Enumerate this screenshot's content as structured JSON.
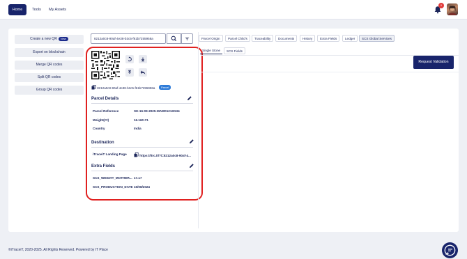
{
  "nav": {
    "home": "Home",
    "tools": "Tools",
    "assets": "My Assets",
    "notification_count": "0"
  },
  "menu": {
    "create": "Create a new QR",
    "new_badge": "New",
    "export": "Export on blockchain",
    "merge": "Merge QR codes",
    "split": "Split QR codes",
    "group": "Group QR codes"
  },
  "search": {
    "value": "8212a0c8-90af-4e38-b3c5-f61b7255958a"
  },
  "asset": {
    "id": "8212a0c8-90af-4e38-b3c5-f61b7255958a",
    "type_badge": "Parcel"
  },
  "parcel_details": {
    "title": "Parcel Details",
    "rows": [
      {
        "label": "Parcel Reference",
        "value": "SK-16-09-2025-MAW01213G34"
      },
      {
        "label": "Weight(Ct)",
        "value": "16.160 Ct."
      },
      {
        "label": "Country",
        "value": "India"
      }
    ]
  },
  "destination": {
    "title": "Destination",
    "label": "iTraceiT Landing Page",
    "value": "https://itrc.it/?i=8212a0c8-90af-4..."
  },
  "extra_fields": {
    "title": "Extra Fields",
    "rows": [
      {
        "label": "SCS_WEIGHT_MOTHER...",
        "value": "17.17"
      },
      {
        "label": "SCS_PRODUCTION_DATE",
        "value": "15/08/2024"
      }
    ]
  },
  "tabs": [
    "Parcel Origin",
    "Parcel Child's",
    "Traceability",
    "Documents",
    "History",
    "Extra Fields",
    "Ledger",
    "SCS Global Services"
  ],
  "subtabs": [
    "Single Stone",
    "SCS Fields"
  ],
  "request_button": "Request Validation",
  "footer": {
    "text": "©iTraceiT, 2020-2025. All Rights Reserved. Powered by",
    "brand": "IT Place"
  },
  "colors": {
    "primary": "#18246b",
    "highlight": "#e0201f",
    "badge": "#2e7bd8"
  }
}
